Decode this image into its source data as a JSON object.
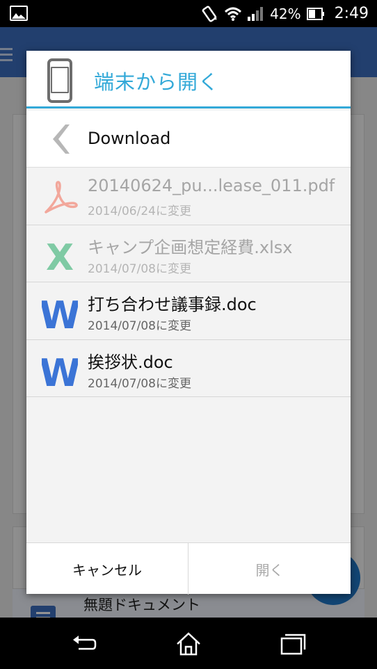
{
  "status_bar": {
    "battery": "42%",
    "time": "2:49",
    "icons": [
      "image-notification-icon",
      "vibrate-icon",
      "wifi-icon",
      "signal-icon",
      "battery-icon"
    ]
  },
  "background": {
    "document_title": "無題ドキュメント"
  },
  "dialog": {
    "title": "端末から開く",
    "folder": {
      "name": "Download",
      "back_icon": "chevron-left-icon"
    },
    "files": [
      {
        "name": "20140624_pu...lease_011.pdf",
        "date": "2014/06/24に変更",
        "type": "pdf",
        "enabled": false
      },
      {
        "name": "キャンプ企画想定経費.xlsx",
        "date": "2014/07/08に変更",
        "type": "xlsx",
        "enabled": false
      },
      {
        "name": "打ち合わせ議事録.doc",
        "date": "2014/07/08に変更",
        "type": "doc",
        "enabled": true
      },
      {
        "name": "挨拶状.doc",
        "date": "2014/07/08に変更",
        "type": "doc",
        "enabled": true
      }
    ],
    "buttons": {
      "cancel": "キャンセル",
      "open": "開く"
    }
  },
  "colors": {
    "accent": "#33a9d8",
    "word_blue": "#3b74d6",
    "excel_green": "#7fcaa4",
    "pdf_red": "#f2a79b"
  }
}
